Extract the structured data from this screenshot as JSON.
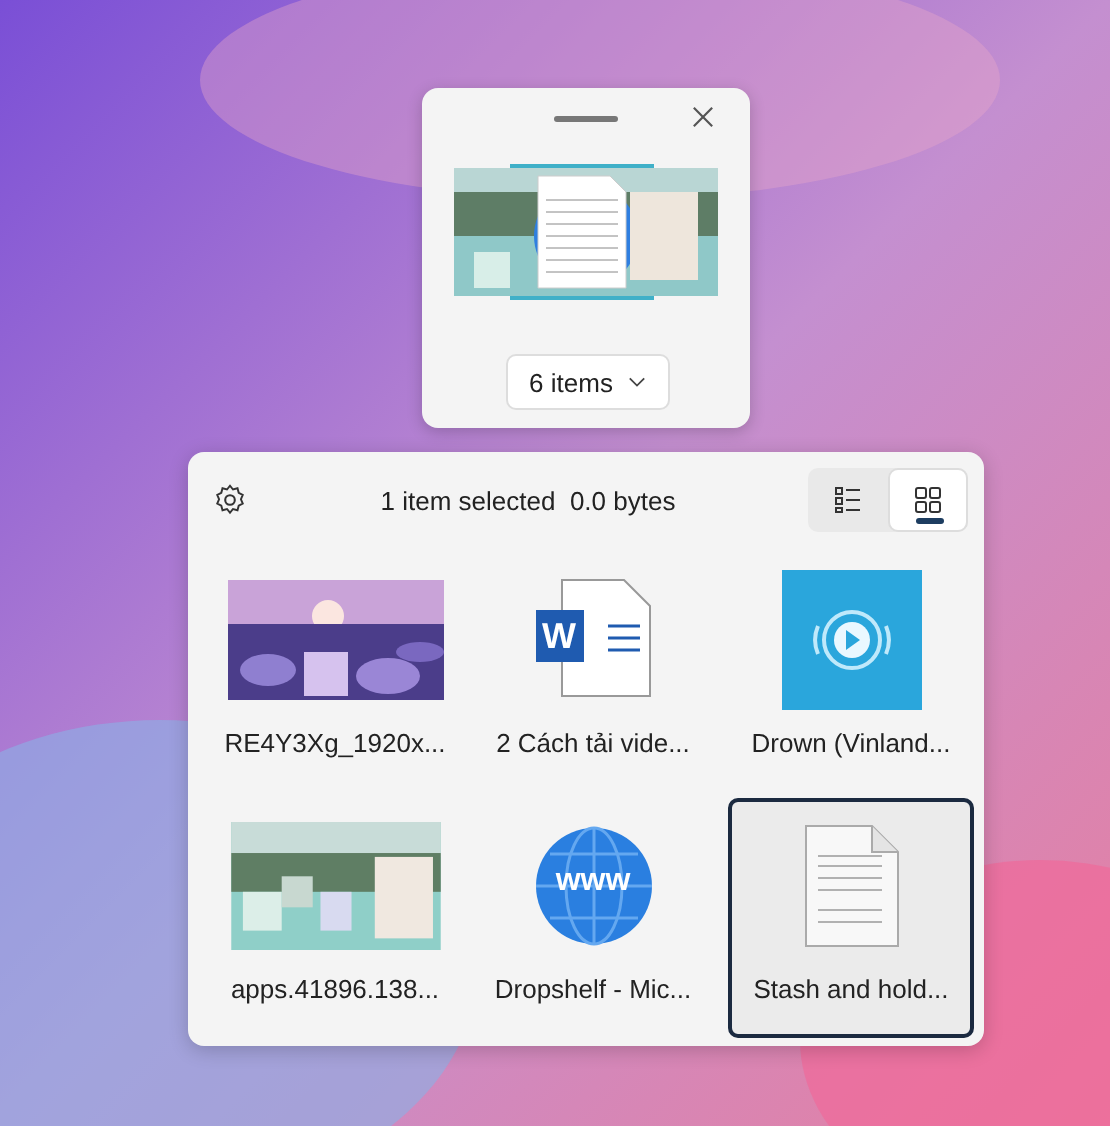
{
  "preview": {
    "count_button": "6 items"
  },
  "shelf": {
    "status": "1 item selected  0.0 bytes",
    "views": [
      {
        "kind": "list",
        "selected": false
      },
      {
        "kind": "grid",
        "selected": true
      }
    ],
    "items": [
      {
        "name": "RE4Y3Xg_1920x...",
        "selected": false
      },
      {
        "kind": "word",
        "name": "2 Cách tải vide...",
        "icon_text": "W",
        "selected": false
      },
      {
        "kind": "audio",
        "name": "Drown (Vinland...",
        "selected": false
      },
      {
        "kind": "screenshot",
        "name": "apps.41896.138...",
        "selected": false
      },
      {
        "kind": "web",
        "name": "Dropshelf - Mic...",
        "icon_text": "www",
        "selected": false
      },
      {
        "kind": "text",
        "name": "Stash and hold...",
        "selected": true
      }
    ]
  }
}
